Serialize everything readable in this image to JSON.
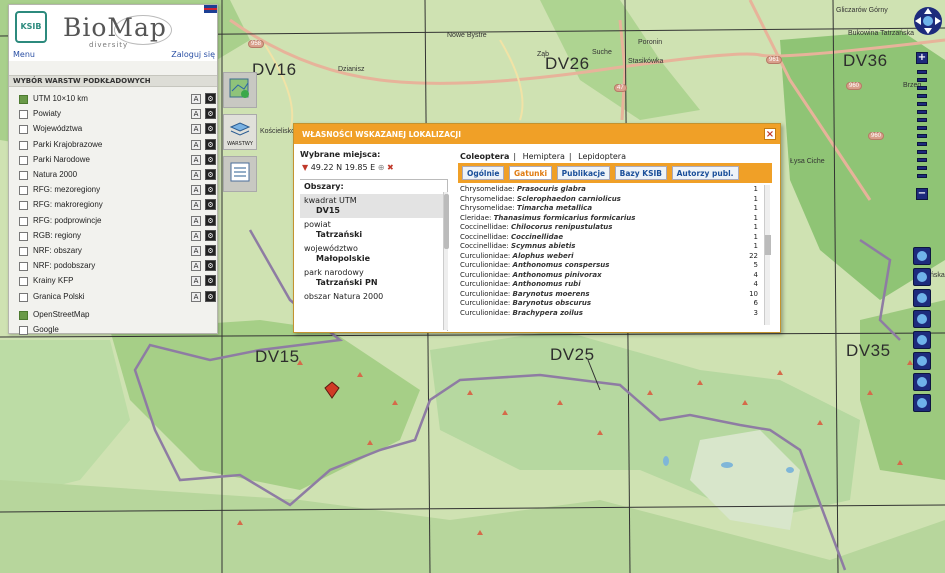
{
  "app": {
    "logo_text": "BioMap",
    "logo_sub": "diversity",
    "logo_badge": "KSIB",
    "menu_label": "Menu",
    "login_label": "Zaloguj się"
  },
  "layers": {
    "header": "WYBÓR WARSTW PODKŁADOWYCH",
    "items": [
      {
        "label": "UTM 10×10 km",
        "checked": true
      },
      {
        "label": "Powiaty",
        "checked": false
      },
      {
        "label": "Województwa",
        "checked": false
      },
      {
        "label": "Parki Krajobrazowe",
        "checked": false
      },
      {
        "label": "Parki Narodowe",
        "checked": false
      },
      {
        "label": "Natura 2000",
        "checked": false
      },
      {
        "label": "RFG: mezoregiony",
        "checked": false
      },
      {
        "label": "RFG: makroregiony",
        "checked": false
      },
      {
        "label": "RFG: podprowincje",
        "checked": false
      },
      {
        "label": "RGB: regiony",
        "checked": false
      },
      {
        "label": "NRF: obszary",
        "checked": false
      },
      {
        "label": "NRF: podobszary",
        "checked": false
      },
      {
        "label": "Krainy KFP",
        "checked": false
      },
      {
        "label": "Granica Polski",
        "checked": false
      },
      {
        "label": "OpenStreetMap",
        "checked": true
      },
      {
        "label": "Google",
        "checked": false
      }
    ],
    "btn_a": "A"
  },
  "tools": {
    "layers_label": "WARSTWY"
  },
  "dialog": {
    "title": "WŁASNOŚCI WSKAZANEJ LOKALIZACJI",
    "close": "×",
    "wybrane_label": "Wybrane miejsca:",
    "lat": "49.22 N",
    "lon": "19.85 E",
    "obszary_label": "Obszary:",
    "obszary": [
      {
        "k": "kwadrat UTM",
        "v": "DV15"
      },
      {
        "k": "powiat",
        "v": "Tatrzański"
      },
      {
        "k": "województwo",
        "v": "Małopolskie"
      },
      {
        "k": "park narodowy",
        "v": "Tatrzański PN"
      },
      {
        "k": "obszar Natura 2000",
        "v": ""
      }
    ],
    "order_tabs": [
      "Coleoptera",
      "Hemiptera",
      "Lepidoptera"
    ],
    "sep": "|",
    "sub_tabs": [
      "Ogólnie",
      "Gatunki",
      "Publikacje",
      "Bazy KSIB",
      "Autorzy publ."
    ],
    "species": [
      {
        "g": "Chrysomelidae:",
        "n": "Prasocuris glabra",
        "c": "1"
      },
      {
        "g": "Chrysomelidae:",
        "n": "Sclerophaedon carniolicus",
        "c": "1"
      },
      {
        "g": "Chrysomelidae:",
        "n": "Timarcha metallica",
        "c": "1"
      },
      {
        "g": "Cleridae:",
        "n": "Thanasimus formicarius formicarius",
        "c": "1"
      },
      {
        "g": "Coccinellidae:",
        "n": "Chilocorus renipustulatus",
        "c": "1"
      },
      {
        "g": "Coccinellidae:",
        "n": "Coccinellidae",
        "c": "1"
      },
      {
        "g": "Coccinellidae:",
        "n": "Scymnus abietis",
        "c": "1"
      },
      {
        "g": "Curculionidae:",
        "n": "Alophus weberi",
        "c": "22"
      },
      {
        "g": "Curculionidae:",
        "n": "Anthonomus conspersus",
        "c": "5"
      },
      {
        "g": "Curculionidae:",
        "n": "Anthonomus pinivorax",
        "c": "4"
      },
      {
        "g": "Curculionidae:",
        "n": "Anthonomus rubi",
        "c": "4"
      },
      {
        "g": "Curculionidae:",
        "n": "Barynotus moerens",
        "c": "10"
      },
      {
        "g": "Curculionidae:",
        "n": "Barynotus obscurus",
        "c": "6"
      },
      {
        "g": "Curculionidae:",
        "n": "Brachypera zoilus",
        "c": "3"
      }
    ]
  },
  "map": {
    "squares": [
      "DV16",
      "DV26",
      "DV36",
      "DV15",
      "DV25",
      "DV35"
    ],
    "towns": [
      "Gliczarów Górny",
      "Nowe Bystre",
      "Ząb",
      "Suche",
      "Poronin",
      "Bukowina Tatrzańska",
      "Dzianisz",
      "Stasikówka",
      "Brzeg",
      "Kościelisko",
      "Łysa Ciche",
      "ńska"
    ],
    "roads": [
      "958",
      "47",
      "961",
      "960",
      "960"
    ]
  }
}
